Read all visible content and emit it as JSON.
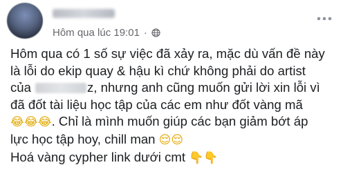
{
  "post": {
    "timestamp": "Hôm qua lúc 19:01",
    "separator": "·",
    "privacy_icon": "globe-icon",
    "menu_icon": "more-options-icon",
    "lines": [
      {
        "text": "Hôm qua có 1 số sự việc đã xảy ra, mặc dù vấn đề này"
      },
      {
        "text": "là lỗi do ekip quay & hậu kì chứ không phải do artist"
      },
      {
        "before": "của",
        "after": "z, nhưng anh cũng muốn gửi lời xin lỗi vì"
      },
      {
        "text": "đã đốt tài liệu học tập của các em như đốt vàng mã"
      },
      {
        "emoji": "😂😂😂",
        "text": ". Chỉ là mình muốn giúp các bạn giảm bớt áp"
      },
      {
        "text": "lực học tập hoy, chill man",
        "emoji": "😌😌"
      },
      {
        "text": "Hoá vàng cypher link dưới cmt",
        "emoji": "👇👇"
      }
    ]
  }
}
